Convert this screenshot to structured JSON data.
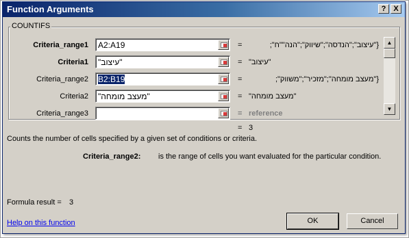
{
  "window": {
    "title": "Function Arguments",
    "help_btn": "?",
    "close_btn": "X"
  },
  "function_name": "COUNTIFS",
  "args": [
    {
      "label": "Criteria_range1",
      "value": "A2:A19",
      "result": "{\"עיצוב\";\"הנדסה\";\"שיווק\";\"הנה\"\"ח\";",
      "bold": true
    },
    {
      "label": "Criteria1",
      "value": "\"עיצוב\"",
      "result": "\"עיצוב\"",
      "bold": true
    },
    {
      "label": "Criteria_range2",
      "value": "B2:B19",
      "result": "{\"מעצב מומחה\";\"מזכיר\";\"משווק\";",
      "bold": false
    },
    {
      "label": "Criteria2",
      "value": "\"מעצב מומחה\"",
      "result": "\"מעצב מומחה\"",
      "bold": false
    },
    {
      "label": "Criteria_range3",
      "value": "",
      "result": "reference",
      "bold": false
    }
  ],
  "equals_sign": "=",
  "total_result": "3",
  "description": "Counts the number of cells specified by a given set of conditions or criteria.",
  "arg_help": {
    "name": "Criteria_range2:",
    "text": "is the range of cells you want evaluated for the particular condition."
  },
  "formula_result": {
    "label": "Formula result =",
    "value": "3"
  },
  "help_link": "Help on this function",
  "buttons": {
    "ok": "OK",
    "cancel": "Cancel"
  }
}
